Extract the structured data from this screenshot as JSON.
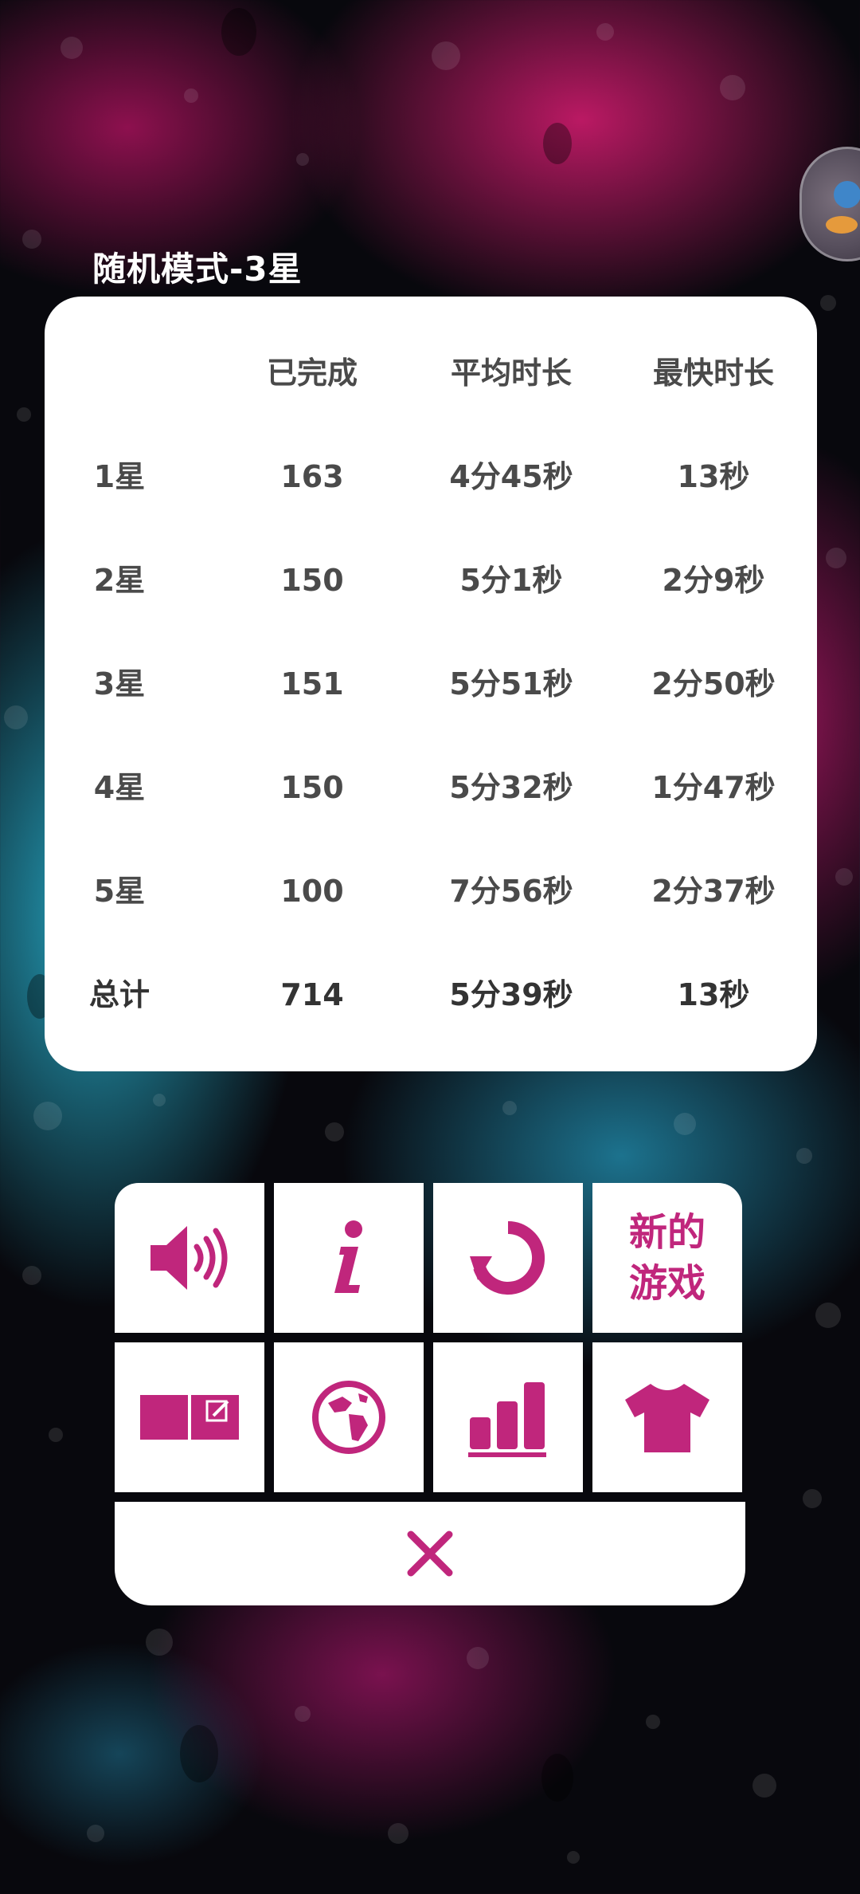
{
  "header": {
    "title": "随机模式-3星"
  },
  "stats": {
    "columns": [
      "",
      "已完成",
      "平均时长",
      "最快时长"
    ],
    "rows": [
      {
        "label": "1星",
        "completed": "163",
        "average": "4分45秒",
        "fastest": "13秒"
      },
      {
        "label": "2星",
        "completed": "150",
        "average": "5分1秒",
        "fastest": "2分9秒"
      },
      {
        "label": "3星",
        "completed": "151",
        "average": "5分51秒",
        "fastest": "2分50秒"
      },
      {
        "label": "4星",
        "completed": "150",
        "average": "5分32秒",
        "fastest": "1分47秒"
      },
      {
        "label": "5星",
        "completed": "100",
        "average": "7分56秒",
        "fastest": "2分37秒"
      }
    ],
    "total": {
      "label": "总计",
      "completed": "714",
      "average": "5分39秒",
      "fastest": "13秒"
    }
  },
  "menu": {
    "accent_color": "#c0267c",
    "tiles": [
      {
        "icon": "sound-icon"
      },
      {
        "icon": "info-icon"
      },
      {
        "icon": "restart-icon"
      },
      {
        "label": "新的游戏"
      },
      {
        "icon": "notes-icon"
      },
      {
        "icon": "globe-icon"
      },
      {
        "icon": "stats-icon"
      },
      {
        "icon": "shirt-icon"
      }
    ],
    "close_icon": "close-icon"
  },
  "floating_button": {
    "icon": "avatar-icon"
  }
}
